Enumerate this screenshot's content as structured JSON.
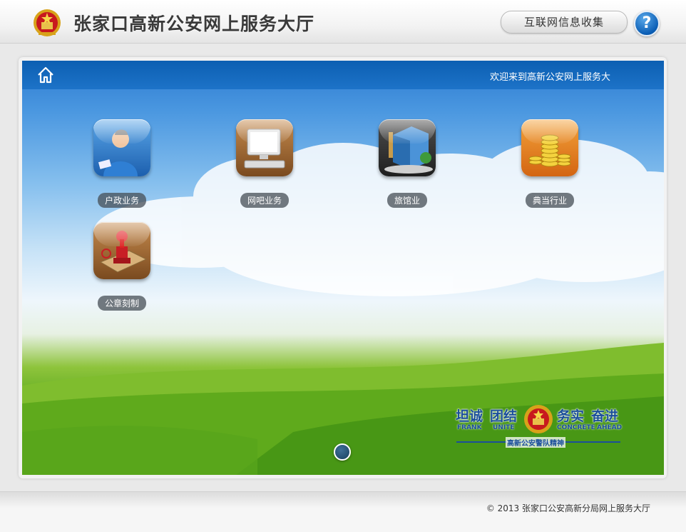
{
  "header": {
    "site_title": "张家口高新公安网上服务大厅",
    "info_button": "互联网信息收集",
    "help_label": "?"
  },
  "stage": {
    "welcome_text": "欢迎来到高新公安网上服务大",
    "tiles": [
      {
        "label": "户政业务",
        "icon": "person-icon"
      },
      {
        "label": "网吧业务",
        "icon": "computer-icon"
      },
      {
        "label": "旅馆业",
        "icon": "hotel-icon"
      },
      {
        "label": "典当行业",
        "icon": "coins-icon"
      },
      {
        "label": "公章刻制",
        "icon": "stamp-icon"
      }
    ],
    "motto": {
      "cn_1": "坦诚",
      "cn_2": "团结",
      "cn_3": "务实",
      "cn_4": "奋进",
      "en_1": "FRANK",
      "en_2": "UNITE",
      "en_3": "CONCRETE",
      "en_4": "AHEAD",
      "subtitle": "高新公安警队精神"
    }
  },
  "footer": {
    "copyright": "© 2013 张家口公安高新分局网上服务大厅"
  }
}
